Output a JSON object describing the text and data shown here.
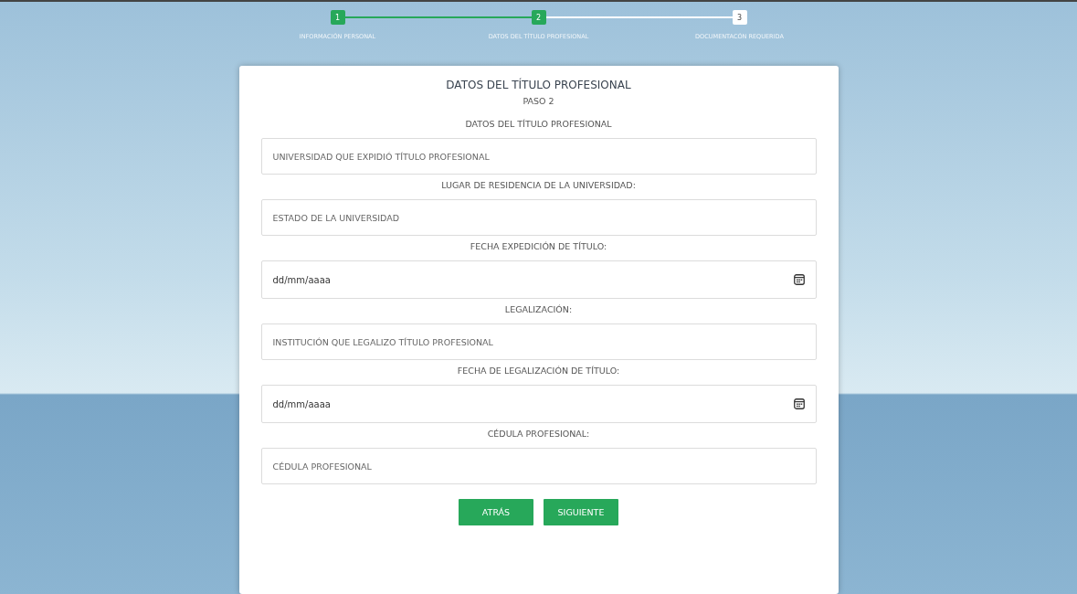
{
  "stepper": [
    {
      "number": "1",
      "label": "INFORMACIÓN PERSONAL",
      "reached": true
    },
    {
      "number": "2",
      "label": "DATOS DEL TÍTULO PROFESIONAL",
      "reached": true
    },
    {
      "number": "3",
      "label": "DOCUMENTACÓN REQUERIDA",
      "reached": false
    }
  ],
  "form": {
    "title": "DATOS DEL TÍTULO PROFESIONAL",
    "step": "PASO 2",
    "fields": [
      {
        "label": "DATOS DEL TÍTULO PROFESIONAL",
        "kind": "text",
        "placeholder": "UNIVERSIDAD QUE EXPIDIÓ TÍTULO PROFESIONAL"
      },
      {
        "label": "LUGAR DE RESIDENCIA DE LA UNIVERSIDAD:",
        "kind": "text",
        "placeholder": "ESTADO DE LA UNIVERSIDAD"
      },
      {
        "label": "FECHA EXPEDICIÓN DE TÍTULO:",
        "kind": "date",
        "placeholder": "dd/mm/aaaa"
      },
      {
        "label": "LEGALIZACIÓN:",
        "kind": "text",
        "placeholder": "INSTITUCIÓN QUE LEGALIZO TÍTULO PROFESIONAL"
      },
      {
        "label": "FECHA DE LEGALIZACIÓN DE TÍTULO:",
        "kind": "date",
        "placeholder": "dd/mm/aaaa"
      },
      {
        "label": "CÉDULA PROFESIONAL:",
        "kind": "text",
        "placeholder": "CÉDULA PROFESIONAL"
      }
    ],
    "buttons": [
      "ATRÁS",
      "SIGUIENTE"
    ]
  }
}
